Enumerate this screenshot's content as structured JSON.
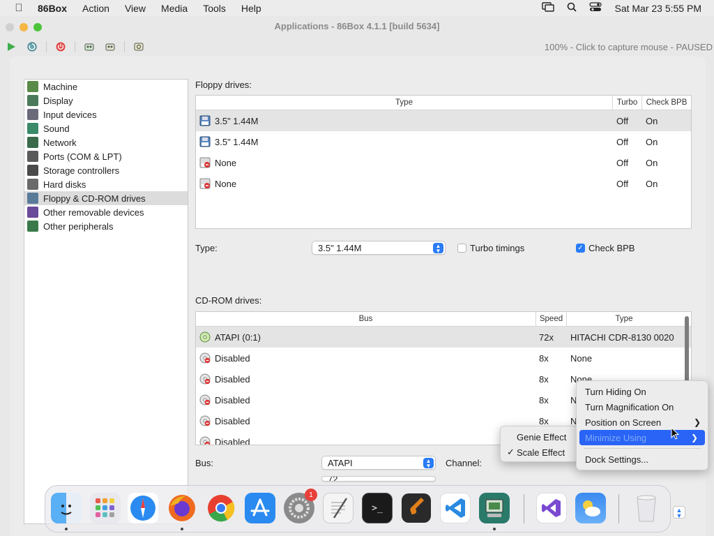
{
  "menubar": {
    "app_name": "86Box",
    "items": [
      "Action",
      "View",
      "Media",
      "Tools",
      "Help"
    ],
    "datetime": "Sat Mar 23  5:55 PM"
  },
  "window": {
    "title": "Applications - 86Box 4.1.1 [build 5634]",
    "status": "100% - Click to capture mouse - PAUSED"
  },
  "sidebar": {
    "items": [
      {
        "label": "Machine",
        "icon": "machine-icon",
        "color": "#5a8a4a"
      },
      {
        "label": "Display",
        "icon": "display-icon",
        "color": "#4a7a5a"
      },
      {
        "label": "Input devices",
        "icon": "input-devices-icon",
        "color": "#6a6a7a"
      },
      {
        "label": "Sound",
        "icon": "sound-icon",
        "color": "#3a8a6a"
      },
      {
        "label": "Network",
        "icon": "network-icon",
        "color": "#3a6a4a"
      },
      {
        "label": "Ports (COM & LPT)",
        "icon": "ports-icon",
        "color": "#5a5a5a"
      },
      {
        "label": "Storage controllers",
        "icon": "storage-controllers-icon",
        "color": "#4a4a4a"
      },
      {
        "label": "Hard disks",
        "icon": "hard-disks-icon",
        "color": "#6a6a6a"
      },
      {
        "label": "Floppy & CD-ROM drives",
        "icon": "floppy-cdrom-icon",
        "color": "#5a7a9a"
      },
      {
        "label": "Other removable devices",
        "icon": "removable-devices-icon",
        "color": "#6a4a9a"
      },
      {
        "label": "Other peripherals",
        "icon": "peripherals-icon",
        "color": "#3a7a4a"
      }
    ],
    "selected_index": 8
  },
  "floppy": {
    "section_label": "Floppy drives:",
    "headers": {
      "type": "Type",
      "turbo": "Turbo",
      "check_bpb": "Check BPB"
    },
    "rows": [
      {
        "type": "3.5\" 1.44M",
        "turbo": "Off",
        "check_bpb": "On",
        "icon": "floppy-disk-icon"
      },
      {
        "type": "3.5\" 1.44M",
        "turbo": "Off",
        "check_bpb": "On",
        "icon": "floppy-disk-icon"
      },
      {
        "type": "None",
        "turbo": "Off",
        "check_bpb": "On",
        "icon": "floppy-disabled-icon"
      },
      {
        "type": "None",
        "turbo": "Off",
        "check_bpb": "On",
        "icon": "floppy-disabled-icon"
      }
    ],
    "type_label": "Type:",
    "type_value": "3.5\" 1.44M",
    "turbo_label": "Turbo timings",
    "turbo_checked": false,
    "check_bpb_label": "Check BPB",
    "check_bpb_checked": true
  },
  "cdrom": {
    "section_label": "CD-ROM drives:",
    "headers": {
      "bus": "Bus",
      "speed": "Speed",
      "type": "Type"
    },
    "rows": [
      {
        "bus": "ATAPI (0:1)",
        "speed": "72x",
        "type": "HITACHI CDR-8130 0020",
        "icon": "cdrom-enabled-icon"
      },
      {
        "bus": "Disabled",
        "speed": "8x",
        "type": "None",
        "icon": "cdrom-disabled-icon"
      },
      {
        "bus": "Disabled",
        "speed": "8x",
        "type": "None",
        "icon": "cdrom-disabled-icon"
      },
      {
        "bus": "Disabled",
        "speed": "8x",
        "type": "N",
        "icon": "cdrom-disabled-icon"
      },
      {
        "bus": "Disabled",
        "speed": "8x",
        "type": "N",
        "icon": "cdrom-disabled-icon"
      },
      {
        "bus": "Disabled",
        "speed": "",
        "type": "",
        "icon": "cdrom-disabled-icon"
      }
    ],
    "bus_label": "Bus:",
    "bus_value": "ATAPI",
    "channel_label": "Channel:",
    "speed_value": "72"
  },
  "dock_menu": {
    "items": [
      {
        "label": "Turn Hiding On",
        "submenu": false
      },
      {
        "label": "Turn Magnification On",
        "submenu": false
      },
      {
        "label": "Position on Screen",
        "submenu": true
      },
      {
        "label": "Minimize Using",
        "submenu": true,
        "highlighted": true
      }
    ],
    "settings_label": "Dock Settings..."
  },
  "minimize_submenu": {
    "items": [
      {
        "label": "Genie Effect",
        "checked": false
      },
      {
        "label": "Scale Effect",
        "checked": true
      }
    ]
  },
  "dock": {
    "apps": [
      "finder",
      "launchpad",
      "safari",
      "firefox",
      "chrome",
      "app-store",
      "system-settings",
      "textedit",
      "terminal",
      "garageband",
      "vscode",
      "86box",
      "visual-studio",
      "weather",
      "trash"
    ],
    "badge_count": "1",
    "colors": {
      "accent": "#2a7cf6",
      "highlight": "#2a64f6"
    }
  }
}
